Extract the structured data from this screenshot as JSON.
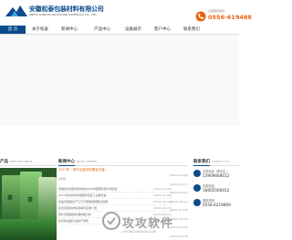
{
  "header": {
    "company_cn": "安徽松泰包装材料有限公司",
    "company_en": "ANHUI SONGTAI PACKAGING MATERIALS CO., LTD.",
    "phone_label": "全国服务热线",
    "phone_number": "0556-619488"
  },
  "nav": {
    "items": [
      {
        "label": "首 页",
        "active": true
      },
      {
        "label": "关于松泰"
      },
      {
        "label": "新闻中心"
      },
      {
        "label": "产品中心"
      },
      {
        "label": "设备展示"
      },
      {
        "label": "客户中心"
      },
      {
        "label": "联系我们"
      }
    ]
  },
  "products": {
    "title": "产品",
    "title_en": "PRODUCT NEWS",
    "pkg_text_a": "茶",
    "pkg_text_b": "茶"
  },
  "news": {
    "title": "新闻中心",
    "title_en": "NEWS CENTER",
    "hot_title": "2017年 · 茶叶包装材料展会开幕...",
    "hot_date": "[详细]",
    "rows": [
      {
        "title": "安徽松泰包装材料参加2018中国国际茶叶博览会",
        "date": "[2022-11-09]"
      },
      {
        "title": "2017松泰参加中国国际包装工业展览会",
        "date": "[2022-11-09]"
      },
      {
        "title": "食品包装袋生产工艺与质量控制要点说明",
        "date": "[2022-10-17]"
      },
      {
        "title": "复合包装膜材料选择及应用介绍",
        "date": "[2022-09-21]"
      },
      {
        "title": "茶叶包装袋的防潮性能分析",
        "date": "[2022-08-11]"
      },
      {
        "title": "松泰新设备引进投产通知",
        "date": "[2022-07-28]"
      }
    ],
    "side_dates": [
      "[2022-11-09]",
      "[2022-10-17]",
      "[2022-09-21]",
      "[2022-08-11]",
      "[2022-07-28]",
      "[2022-06-15]",
      "[2022-05-20]",
      "[2022-04-18]"
    ]
  },
  "contact": {
    "title": "联系我们",
    "title_en": "CONTACT US",
    "items": [
      {
        "label": "业务电话（李先生）",
        "value": "13909668012"
      },
      {
        "label": "传真电话：",
        "value": "18605566012"
      },
      {
        "label": "服务热线：",
        "value": "0556-6219809"
      }
    ]
  },
  "watermark": {
    "text": "攻攻软件",
    "url": "ZHONGHUAYUN.COM"
  },
  "colors": {
    "brand": "#0b4c8c",
    "accent": "#e8650c"
  }
}
